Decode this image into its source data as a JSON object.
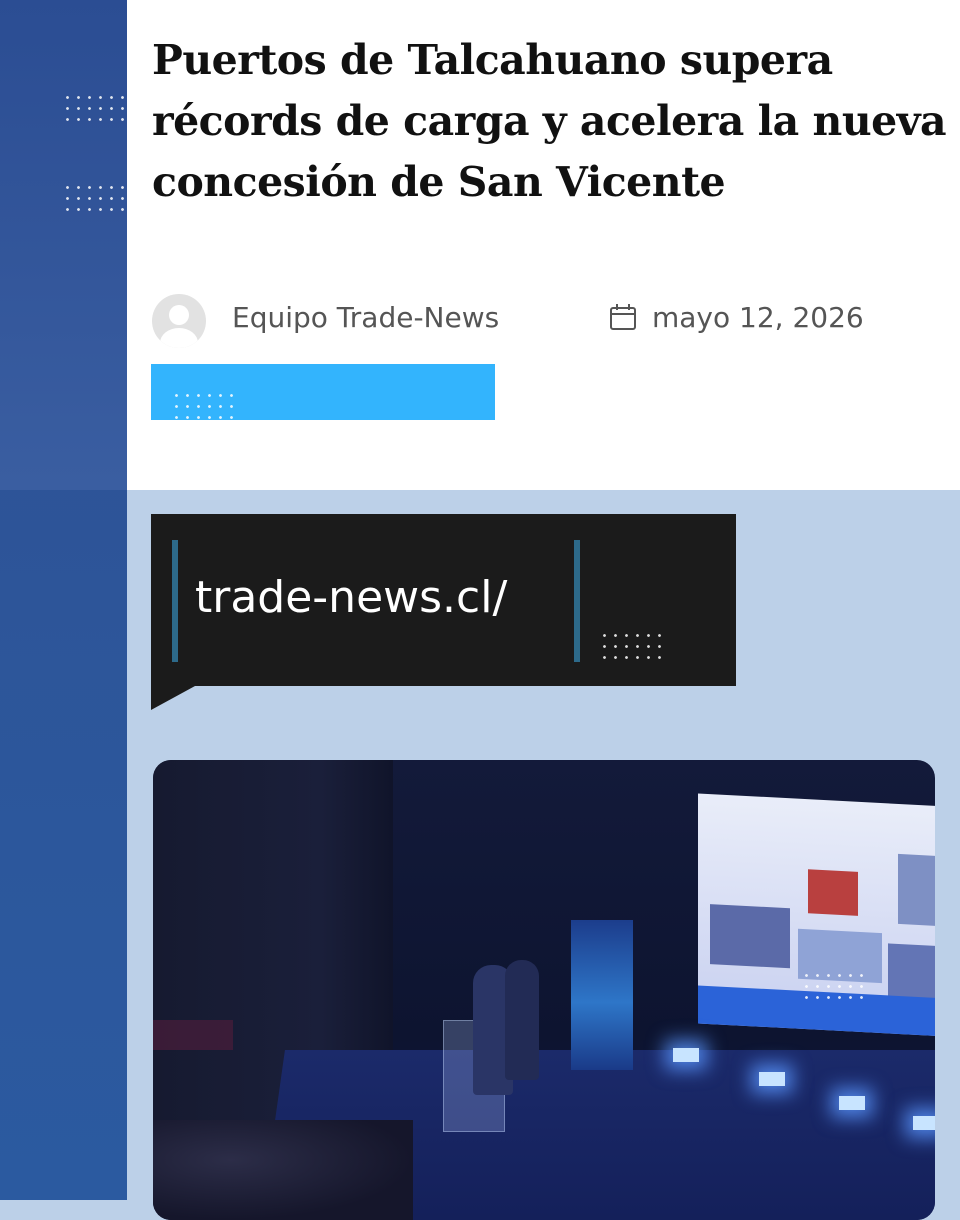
{
  "article": {
    "headline": "Puertos de Talcahuano supera récords de carga y acelera la nueva concesión de San Vicente",
    "author": "Equipo Trade-News",
    "date": "mayo 12, 2026"
  },
  "promo": {
    "url": "trade-news.cl/"
  },
  "icons": {
    "avatar": "user-avatar-placeholder-icon",
    "date": "calendar-icon"
  },
  "colors": {
    "left_band": "#2d5599",
    "accent_bar": "#33b4fd",
    "url_box": "#1b1b1b",
    "page_background": "#bcd0e8"
  }
}
